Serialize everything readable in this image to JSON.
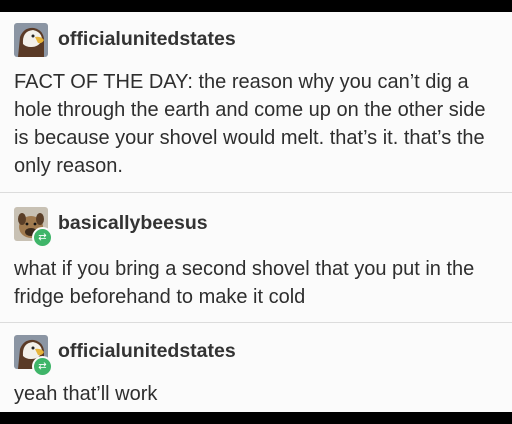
{
  "posts": [
    {
      "username": "officialunitedstates",
      "avatar_icon": "eagle-avatar-icon",
      "reblog": false,
      "text": "FACT OF THE DAY: the reason why you can’t dig a hole through the earth and come up on the other side is because your shovel would melt. that’s it. that’s the only reason."
    },
    {
      "username": "basicallybeesus",
      "avatar_icon": "dog-avatar-icon",
      "reblog": true,
      "reblog_icon": "reblog-icon",
      "text": "what if you bring a second shovel that you put in the fridge beforehand to make it cold"
    },
    {
      "username": "officialunitedstates",
      "avatar_icon": "eagle-avatar-icon",
      "reblog": true,
      "reblog_icon": "reblog-icon",
      "text": "yeah that’ll work"
    }
  ],
  "colors": {
    "frame_background": "#fbfbfb",
    "border_color": "#000000",
    "reblog_green": "#3fb569",
    "text": "#2e2e2e",
    "divider": "#dcdcdc"
  }
}
